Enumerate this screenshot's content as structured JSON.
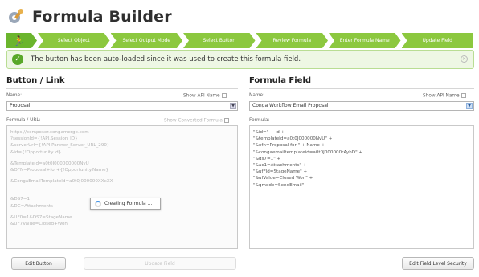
{
  "app": {
    "title": "Formula Builder",
    "logo_icon": "gear-wrench-icon"
  },
  "wizard": {
    "steps": [
      {
        "label": ""
      },
      {
        "label": "Select Object"
      },
      {
        "label": "Select Output Mode"
      },
      {
        "label": "Select Button"
      },
      {
        "label": "Review Formula"
      },
      {
        "label": "Enter Formula Name"
      },
      {
        "label": "Update Field"
      }
    ],
    "runner_icon": "running-man-icon",
    "step_color": "#8cc83f",
    "active_color": "#6bb52d"
  },
  "notice": {
    "text": "The button has been auto-loaded since it was used to create this formula field.",
    "icon": "check-circle-icon",
    "close_icon": "close-icon"
  },
  "left": {
    "title": "Button / Link",
    "name_label": "Name:",
    "show_api": "Show API Name",
    "selected": "Proposal",
    "formula_label": "Formula / URL:",
    "show_converted": "Show Converted Formula",
    "url_lines_1": [
      "https://composer.congamerge.com",
      "?sessionId={!API.Session_ID}",
      "&serverUrl={!API.Partner_Server_URL_290}",
      "&id={!Opportunity.Id}"
    ],
    "url_lines_2": [
      "&TemplateId=a0t0J000000000NvU",
      "&OFN=Proposal+for+{!Opportunity.Name}"
    ],
    "url_lines_3": [
      "&CongaEmailTemplateId=a0t0J000000XXxXX"
    ],
    "url_lines_4": [
      "&DS7=1",
      "&DC=Attachments"
    ],
    "url_lines_5": [
      "&UF0=1&DS7=StageName",
      "&UF7Value=Closed+Won"
    ],
    "loading_text": "Creating Formula ...",
    "edit_button": "Edit Button",
    "update_button": "Update Field"
  },
  "right": {
    "title": "Formula Field",
    "name_label": "Name:",
    "show_api": "Show API Name",
    "selected": "Conga Workflow Email Proposal",
    "formula_label": "Formula:",
    "formula_lines": [
      "\"&id=\" + Id +",
      "\"&templateId=a0t0J000000NvU\" +",
      "\"&ofn=Proposal for \" + Name +",
      "\"&congaemailtemplateid=a0t0J000000rAyhD\" +",
      "\"&ds7=1\" +",
      "\"&ac1=Attachments\" +",
      "\"&ufFld=StageName\" +",
      "\"&ufValue=Closed Won\" +",
      "\"&qmode=SendEmail\""
    ],
    "security_button": "Edit Field Level Security"
  }
}
